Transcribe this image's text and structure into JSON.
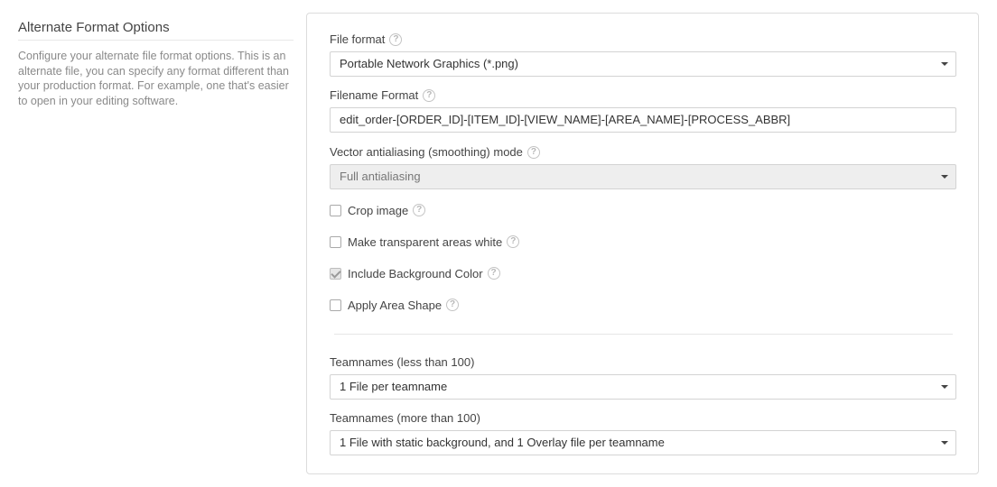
{
  "left": {
    "title": "Alternate Format Options",
    "description": "Configure your alternate file format options. This is an alternate file, you can specify any format different than your production format. For example, one that's easier to open in your editing software."
  },
  "file_format": {
    "label": "File format",
    "value": "Portable Network Graphics (*.png)",
    "help_icon": "question-circle-icon"
  },
  "filename_format": {
    "label": "Filename Format",
    "value": "edit_order-[ORDER_ID]-[ITEM_ID]-[VIEW_NAME]-[AREA_NAME]-[PROCESS_ABBR]"
  },
  "antialiasing": {
    "label": "Vector antialiasing (smoothing) mode",
    "value": "Full antialiasing",
    "disabled": true
  },
  "checkboxes": [
    {
      "label": "Crop image",
      "checked": false
    },
    {
      "label": "Make transparent areas white",
      "checked": false
    },
    {
      "label": "Include Background Color",
      "checked": true
    },
    {
      "label": "Apply Area Shape",
      "checked": false
    }
  ],
  "teamnames_less": {
    "label": "Teamnames (less than 100)",
    "value": "1 File per teamname"
  },
  "teamnames_more": {
    "label": "Teamnames (more than 100)",
    "value": "1 File with static background, and 1 Overlay file per teamname"
  }
}
